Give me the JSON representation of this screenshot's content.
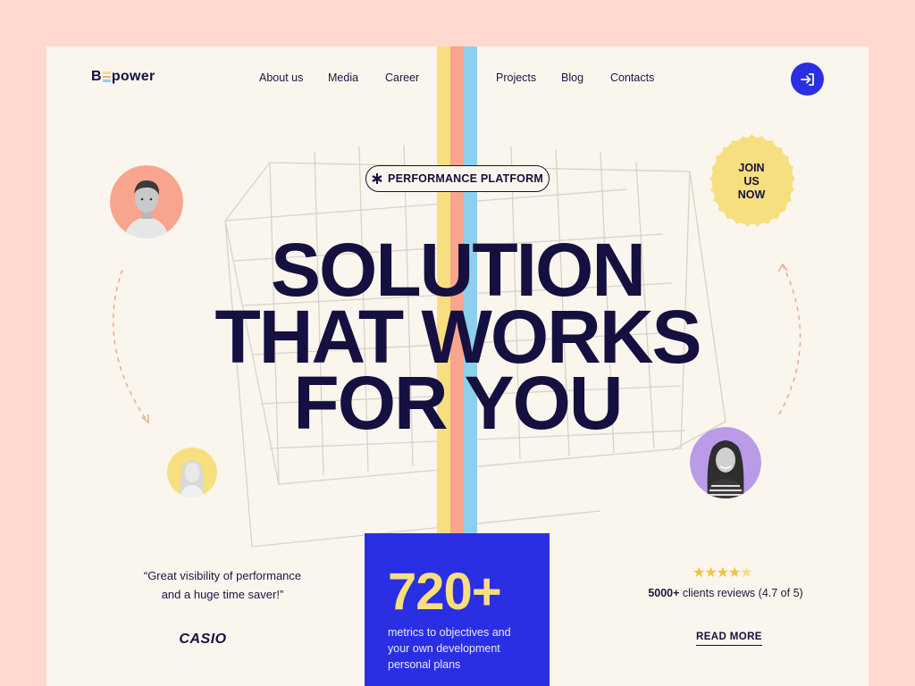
{
  "brand": {
    "logo_prefix": "B",
    "logo_suffix": "power",
    "logo_bar_colors": [
      "#f7df7f",
      "#f7a58c",
      "#8dd0ec"
    ]
  },
  "nav": {
    "items": [
      "About us",
      "Media",
      "Career",
      "Projects",
      "Blog",
      "Contacts"
    ]
  },
  "header": {
    "login_icon": "sign-in-icon"
  },
  "hero": {
    "badge_label": "PERFORMANCE PLATFORM",
    "badge_icon": "asterisk-icon",
    "headline_line1": "SOLUTION",
    "headline_line2": "THAT WORKS",
    "headline_line3": "FOR YOU",
    "join_line1": "JOIN",
    "join_line2": "US",
    "join_line3": "NOW"
  },
  "testimonial": {
    "quote_line1": "Great visibility of performance",
    "quote_line2": "and a huge time saver!",
    "open_quote": "“",
    "close_quote": "”",
    "company": "CASIO"
  },
  "metric": {
    "value": "720+",
    "description": "metrics to objectives and your own development personal plans"
  },
  "reviews": {
    "stars": "★★★★★",
    "rating": 4.7,
    "count": "5000+",
    "text": "clients reviews (4.7 of 5)",
    "read_more": "READ MORE"
  },
  "colors": {
    "background": "#ffd9cf",
    "page": "#faf6ee",
    "ink": "#15103f",
    "accent_blue": "#2a2fe4",
    "yellow": "#f7df7f",
    "coral": "#f7a58c",
    "sky": "#8dd0ec",
    "lilac": "#b99be8"
  }
}
